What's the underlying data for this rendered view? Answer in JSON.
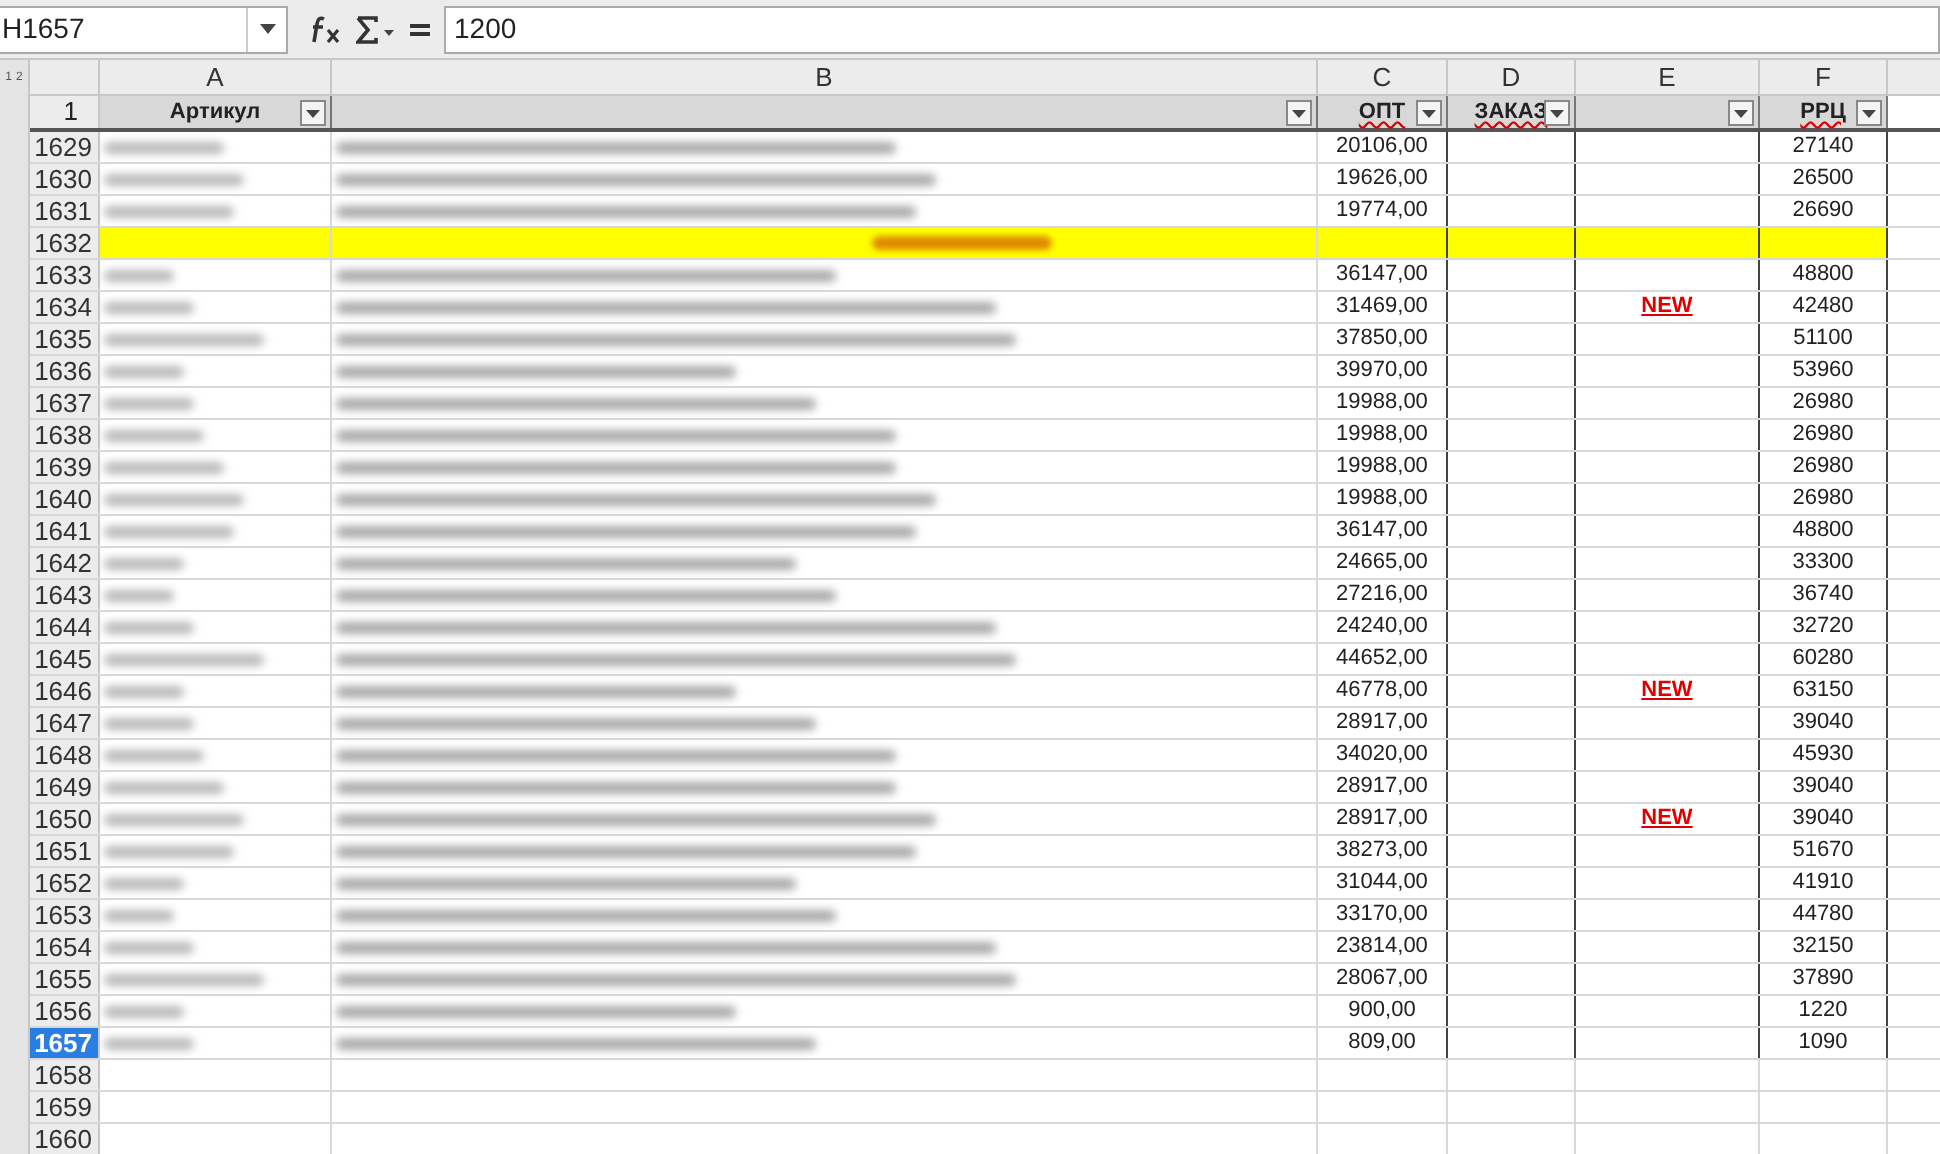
{
  "name_box": "H1657",
  "formula": "1200",
  "outline_levels": [
    "1",
    "2"
  ],
  "columns": [
    {
      "letter": "A",
      "filter": "Артикул"
    },
    {
      "letter": "B"
    },
    {
      "letter": "C",
      "filter": "ОПТ"
    },
    {
      "letter": "D",
      "filter": "ЗАКАЗ"
    },
    {
      "letter": "E"
    },
    {
      "letter": "F",
      "filter": "РРЦ"
    }
  ],
  "header_row": "1",
  "rows": [
    {
      "num": "1629",
      "kind": "item",
      "selected": false,
      "opt": "20106,00",
      "rrc": "27140"
    },
    {
      "num": "1630",
      "kind": "item",
      "selected": false,
      "opt": "19626,00",
      "rrc": "26500"
    },
    {
      "num": "1631",
      "kind": "item",
      "selected": false,
      "opt": "19774,00",
      "rrc": "26690"
    },
    {
      "num": "1632",
      "kind": "group",
      "selected": false
    },
    {
      "num": "1633",
      "kind": "item",
      "selected": false,
      "opt": "36147,00",
      "rrc": "48800"
    },
    {
      "num": "1634",
      "kind": "item",
      "selected": false,
      "opt": "31469,00",
      "new": "NEW",
      "rrc": "42480"
    },
    {
      "num": "1635",
      "kind": "item",
      "selected": false,
      "opt": "37850,00",
      "rrc": "51100"
    },
    {
      "num": "1636",
      "kind": "item",
      "selected": false,
      "opt": "39970,00",
      "rrc": "53960"
    },
    {
      "num": "1637",
      "kind": "item",
      "selected": false,
      "opt": "19988,00",
      "rrc": "26980"
    },
    {
      "num": "1638",
      "kind": "item",
      "selected": false,
      "opt": "19988,00",
      "rrc": "26980"
    },
    {
      "num": "1639",
      "kind": "item",
      "selected": false,
      "opt": "19988,00",
      "rrc": "26980"
    },
    {
      "num": "1640",
      "kind": "item",
      "selected": false,
      "opt": "19988,00",
      "rrc": "26980"
    },
    {
      "num": "1641",
      "kind": "item",
      "selected": false,
      "opt": "36147,00",
      "rrc": "48800"
    },
    {
      "num": "1642",
      "kind": "item",
      "selected": false,
      "opt": "24665,00",
      "rrc": "33300"
    },
    {
      "num": "1643",
      "kind": "item",
      "selected": false,
      "opt": "27216,00",
      "rrc": "36740"
    },
    {
      "num": "1644",
      "kind": "item",
      "selected": false,
      "opt": "24240,00",
      "rrc": "32720"
    },
    {
      "num": "1645",
      "kind": "item",
      "selected": false,
      "opt": "44652,00",
      "rrc": "60280"
    },
    {
      "num": "1646",
      "kind": "item",
      "selected": false,
      "opt": "46778,00",
      "new": "NEW",
      "rrc": "63150"
    },
    {
      "num": "1647",
      "kind": "item",
      "selected": false,
      "opt": "28917,00",
      "rrc": "39040"
    },
    {
      "num": "1648",
      "kind": "item",
      "selected": false,
      "opt": "34020,00",
      "rrc": "45930"
    },
    {
      "num": "1649",
      "kind": "item",
      "selected": false,
      "opt": "28917,00",
      "rrc": "39040"
    },
    {
      "num": "1650",
      "kind": "item",
      "selected": false,
      "opt": "28917,00",
      "new": "NEW",
      "rrc": "39040"
    },
    {
      "num": "1651",
      "kind": "item",
      "selected": false,
      "opt": "38273,00",
      "rrc": "51670"
    },
    {
      "num": "1652",
      "kind": "item",
      "selected": false,
      "opt": "31044,00",
      "rrc": "41910"
    },
    {
      "num": "1653",
      "kind": "item",
      "selected": false,
      "opt": "33170,00",
      "rrc": "44780"
    },
    {
      "num": "1654",
      "kind": "item",
      "selected": false,
      "opt": "23814,00",
      "rrc": "32150"
    },
    {
      "num": "1655",
      "kind": "item",
      "selected": false,
      "opt": "28067,00",
      "rrc": "37890"
    },
    {
      "num": "1656",
      "kind": "item",
      "selected": false,
      "opt": "900,00",
      "rrc": "1220"
    },
    {
      "num": "1657",
      "kind": "item",
      "selected": true,
      "opt": "809,00",
      "rrc": "1090"
    },
    {
      "num": "1658",
      "kind": "empty",
      "selected": false
    },
    {
      "num": "1659",
      "kind": "empty",
      "selected": false
    },
    {
      "num": "1660",
      "kind": "empty",
      "selected": false
    }
  ]
}
